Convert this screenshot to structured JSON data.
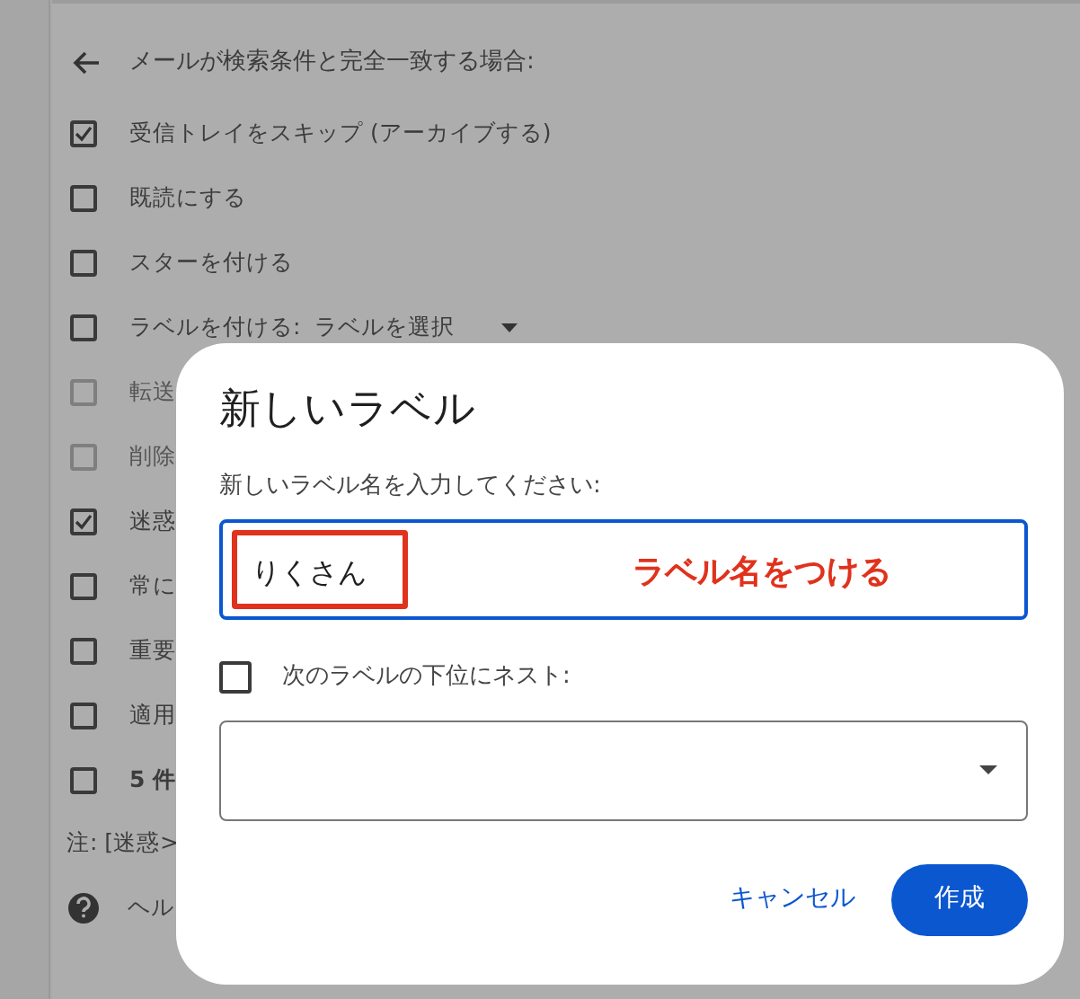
{
  "filter_panel": {
    "header": "メールが検索条件と完全一致する場合:",
    "options": [
      {
        "kind": "check",
        "label": "受信トレイをスキップ (アーカイブする)",
        "checked": true,
        "disabled": false
      },
      {
        "kind": "check",
        "label": "既読にする",
        "checked": false,
        "disabled": false
      },
      {
        "kind": "check",
        "label": "スターを付ける",
        "checked": false,
        "disabled": false
      },
      {
        "kind": "select",
        "label": "ラベルを付ける:",
        "value": "ラベルを選択",
        "checked": false,
        "disabled": false
      },
      {
        "kind": "check",
        "label": "転送",
        "checked": false,
        "disabled": true
      },
      {
        "kind": "check",
        "label": "削除",
        "checked": false,
        "disabled": true
      },
      {
        "kind": "check",
        "label": "迷惑",
        "checked": true,
        "disabled": false
      },
      {
        "kind": "check",
        "label": "常に",
        "checked": false,
        "disabled": false
      },
      {
        "kind": "check",
        "label": "重要",
        "checked": false,
        "disabled": false
      },
      {
        "kind": "check",
        "label": "適用",
        "checked": false,
        "disabled": false
      },
      {
        "kind": "count",
        "label": "5 件",
        "checked": false,
        "disabled": false
      }
    ],
    "note": "注: [迷惑>",
    "help": "ヘル"
  },
  "dialog": {
    "title": "新しいラベル",
    "prompt": "新しいラベル名を入力してください:",
    "name_value": "りくさん",
    "annotation": "ラベル名をつける",
    "nest": {
      "label": "次のラベルの下位にネスト:",
      "checked": false
    },
    "buttons": [
      {
        "kind": "text",
        "label": "キャンセル"
      },
      {
        "kind": "filled",
        "label": "作成"
      }
    ]
  }
}
